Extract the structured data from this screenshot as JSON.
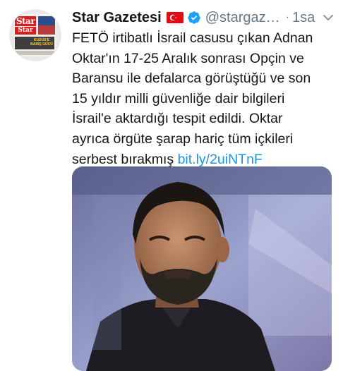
{
  "tweet": {
    "author": {
      "display_name": "Star Gazetesi",
      "handle": "@stargaz…",
      "verified": true,
      "flag": "turkey-flag"
    },
    "avatar": {
      "masthead": "Star",
      "masthead_sub": "Star",
      "headline_caption": "KUDÜS'E BARIŞ GÜCÜ"
    },
    "separator": "·",
    "time": "1sa",
    "text_lines": [
      "FETÖ irtibatlı İsrail casusu çıkan Adnan",
      "Oktar'ın 17-25 Aralık sonrası Opçin ve",
      "Baransu ile defalarca görüştüğü ve son",
      "15 yıldır milli güvenliğe dair bilgileri",
      "İsrail'e aktardığı tespit edildi. Oktar",
      "ayrıca örgüte şarap hariç tüm içkileri",
      "serbest bırakmış"
    ],
    "link_text": "bit.ly/2uiNTnF",
    "media_icon": "video-thumbnail",
    "colors": {
      "link": "#1b95e0",
      "secondary_text": "#657786",
      "verified": "#1da1f2",
      "flag_red": "#e30a17"
    }
  }
}
